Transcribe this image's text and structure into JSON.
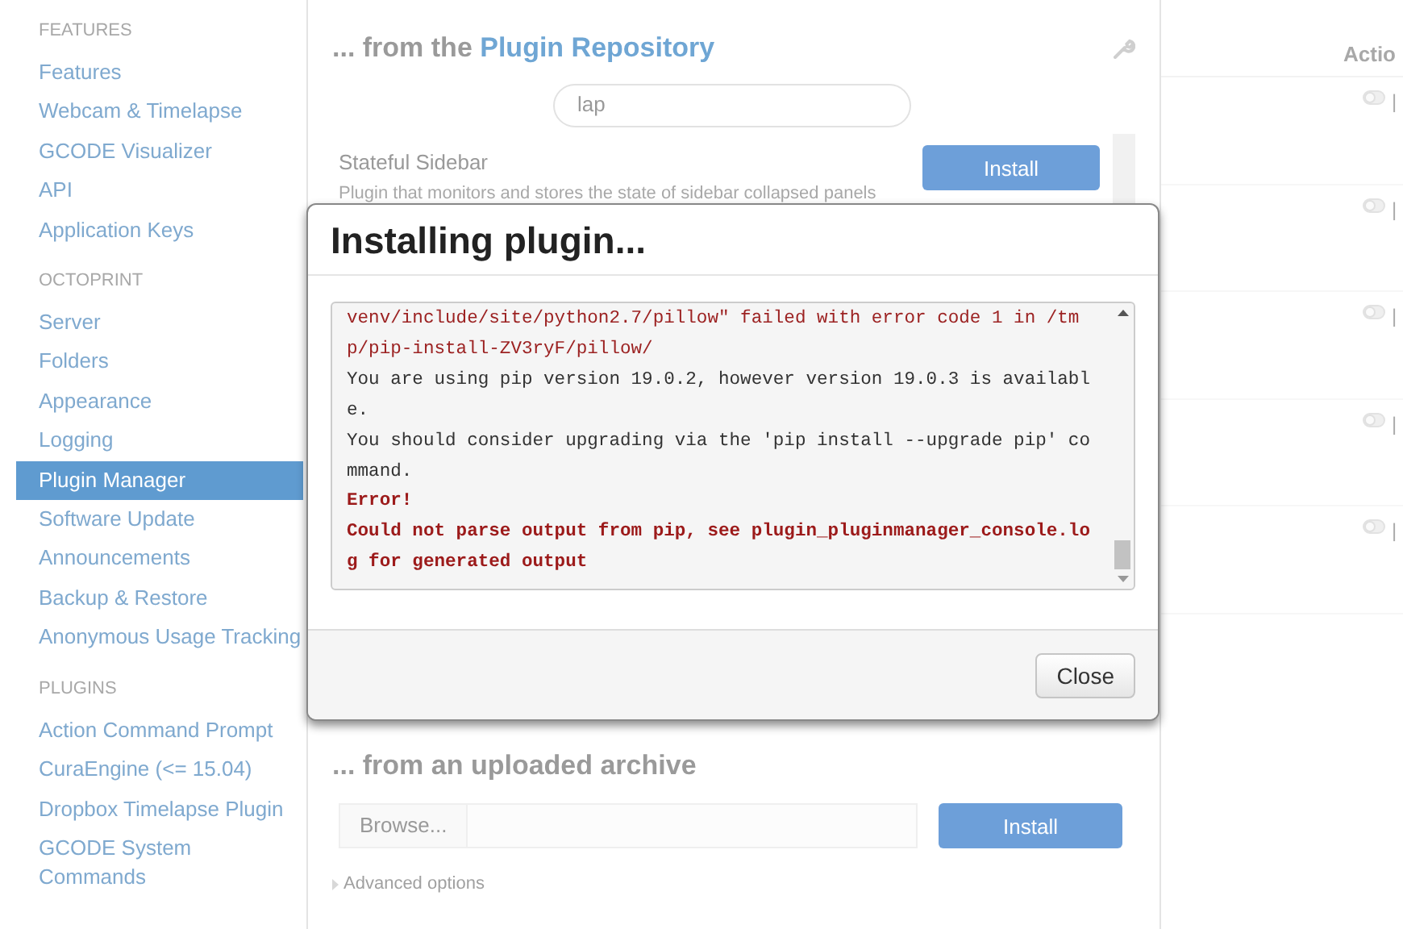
{
  "sidebar": {
    "sections": [
      {
        "heading": "FEATURES",
        "items": [
          {
            "label": "Features",
            "selected": false
          },
          {
            "label": "Webcam & Timelapse",
            "selected": false
          },
          {
            "label": "GCODE Visualizer",
            "selected": false
          },
          {
            "label": "API",
            "selected": false
          },
          {
            "label": "Application Keys",
            "selected": false
          }
        ]
      },
      {
        "heading": "OCTOPRINT",
        "items": [
          {
            "label": "Server",
            "selected": false
          },
          {
            "label": "Folders",
            "selected": false
          },
          {
            "label": "Appearance",
            "selected": false
          },
          {
            "label": "Logging",
            "selected": false
          },
          {
            "label": "Plugin Manager",
            "selected": true
          },
          {
            "label": "Software Update",
            "selected": false
          },
          {
            "label": "Announcements",
            "selected": false
          },
          {
            "label": "Backup & Restore",
            "selected": false
          },
          {
            "label": "Anonymous Usage Tracking",
            "selected": false
          }
        ]
      },
      {
        "heading": "PLUGINS",
        "items": [
          {
            "label": "Action Command Prompt",
            "selected": false
          },
          {
            "label": "CuraEngine (<= 15.04)",
            "selected": false
          },
          {
            "label": "Dropbox Timelapse Plugin",
            "selected": false
          },
          {
            "label": "GCODE System Commands",
            "selected": false
          }
        ]
      }
    ]
  },
  "repository": {
    "title_prefix": "... from the",
    "title_link": "Plugin Repository",
    "search": {
      "value": "lap"
    },
    "plugins": [
      {
        "name": "Stateful Sidebar",
        "description": "Plugin that monitors and stores the state of sidebar collapsed panels",
        "button": "Install"
      }
    ]
  },
  "archive": {
    "title": "... from an uploaded archive",
    "browse": "Browse...",
    "button": "Install",
    "advanced": "Advanced options"
  },
  "table": {
    "columns": [
      "Actio"
    ],
    "rows": [
      {
        "separator": "|"
      },
      {
        "separator": "|"
      },
      {
        "separator": "|"
      },
      {
        "separator": "|"
      },
      {
        "separator": "|"
      }
    ]
  },
  "dialog": {
    "title": "Installing plugin...",
    "log": [
      {
        "kind": "stderr",
        "text": "venv/include/site/python2.7/pillow\" failed with error code 1 in /tmp/pip-install-ZV3ryF/pillow/"
      },
      {
        "kind": "stdout",
        "text": "You are using pip version 19.0.2, however version 19.0.3 is available."
      },
      {
        "kind": "stdout",
        "text": "You should consider upgrading via the 'pip install --upgrade pip' command."
      },
      {
        "kind": "error",
        "text": "Error!"
      },
      {
        "kind": "error",
        "text": "Could not parse output from pip, see plugin_pluginmanager_console.log for generated output"
      }
    ],
    "buttons": [
      "Close"
    ]
  }
}
